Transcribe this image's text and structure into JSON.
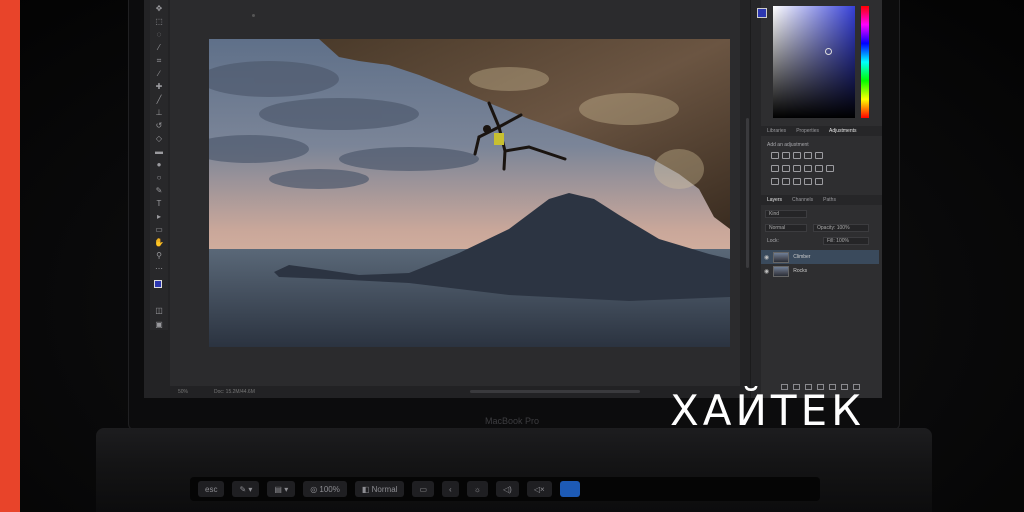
{
  "brand": {
    "watermark": "ХАЙТЕК",
    "laptop_model": "MacBook Pro",
    "accent_color": "#e8442a"
  },
  "photoshop": {
    "tools": [
      "move-icon",
      "marquee-icon",
      "lasso-icon",
      "magic-wand-icon",
      "crop-icon",
      "eyedropper-icon",
      "healing-icon",
      "brush-icon",
      "stamp-icon",
      "history-brush-icon",
      "eraser-icon",
      "gradient-icon",
      "blur-icon",
      "dodge-icon",
      "pen-icon",
      "type-icon",
      "path-select-icon",
      "shape-icon",
      "hand-icon",
      "zoom-icon",
      "more-icon"
    ],
    "foreground_color": "#2c37b0",
    "background_color": "#ffffff",
    "status": {
      "zoom": "50%",
      "doc": "Doc: 15.2M/44.6M"
    },
    "panels": {
      "tabs_top": [
        "Libraries",
        "Properties",
        "Adjustments"
      ],
      "active_tab_top": "Adjustments",
      "add_adjustment": "Add an adjustment",
      "tabs_layers": [
        "Layers",
        "Channels",
        "Paths"
      ],
      "active_tab_layers": "Layers",
      "filter_kind": "Kind",
      "blend_mode": "Normal",
      "opacity": "Opacity: 100%",
      "lock_label": "Lock:",
      "fill": "Fill: 100%",
      "layers": [
        {
          "name": "Climber",
          "selected": true
        },
        {
          "name": "Rocks",
          "selected": false
        }
      ]
    }
  },
  "touch_bar": {
    "keys": [
      {
        "label": "esc",
        "icon": ""
      },
      {
        "label": "",
        "icon": "brush-icon"
      },
      {
        "label": "",
        "icon": "layers-icon"
      },
      {
        "label": "100%",
        "icon": "opacity-icon"
      },
      {
        "label": "Normal",
        "icon": "blend-icon"
      },
      {
        "label": "",
        "icon": "swatch-icon"
      },
      {
        "label": "",
        "icon": "back-icon"
      },
      {
        "label": "",
        "icon": "brightness-icon"
      },
      {
        "label": "",
        "icon": "volume-icon"
      },
      {
        "label": "",
        "icon": "mute-icon"
      },
      {
        "label": "",
        "icon": "siri-icon"
      }
    ]
  }
}
